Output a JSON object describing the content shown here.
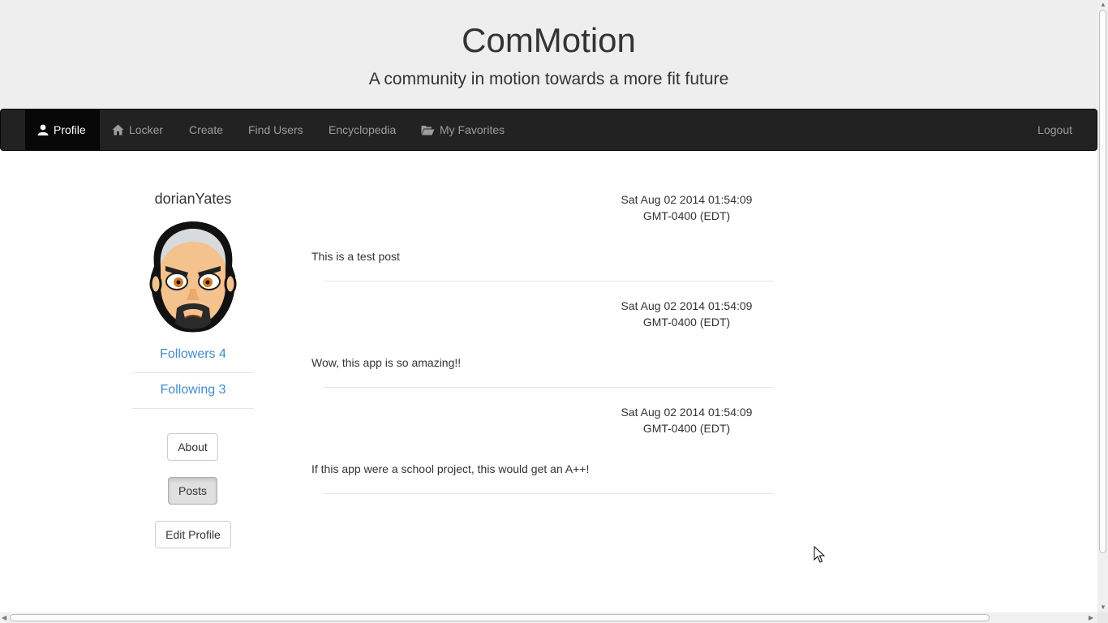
{
  "header": {
    "title": "ComMotion",
    "tagline": "A community in motion towards a more fit future"
  },
  "nav": {
    "items": [
      {
        "label": "Profile",
        "icon": "user-icon"
      },
      {
        "label": "Locker",
        "icon": "home-icon"
      },
      {
        "label": "Create"
      },
      {
        "label": "Find Users"
      },
      {
        "label": "Encyclopedia"
      },
      {
        "label": "My Favorites",
        "icon": "folder-open-icon"
      }
    ],
    "logout": "Logout"
  },
  "profile": {
    "username": "dorianYates",
    "avatar": "bald-goatee-man-avatar",
    "followers": "Followers 4",
    "following": "Following 3",
    "about_label": "About",
    "posts_label": "Posts",
    "edit_label": "Edit Profile"
  },
  "posts": [
    {
      "date": "Sat Aug 02 2014 01:54:09 GMT-0400 (EDT)",
      "body": "This is a test post"
    },
    {
      "date": "Sat Aug 02 2014 01:54:09 GMT-0400 (EDT)",
      "body": "Wow, this app is so amazing!!"
    },
    {
      "date": "Sat Aug 02 2014 01:54:09 GMT-0400 (EDT)",
      "body": "If this app were a school project, this would get an A++!"
    }
  ],
  "colors": {
    "navbar": "#222222",
    "link": "#428bca",
    "jumbotron": "#eeeeee"
  }
}
